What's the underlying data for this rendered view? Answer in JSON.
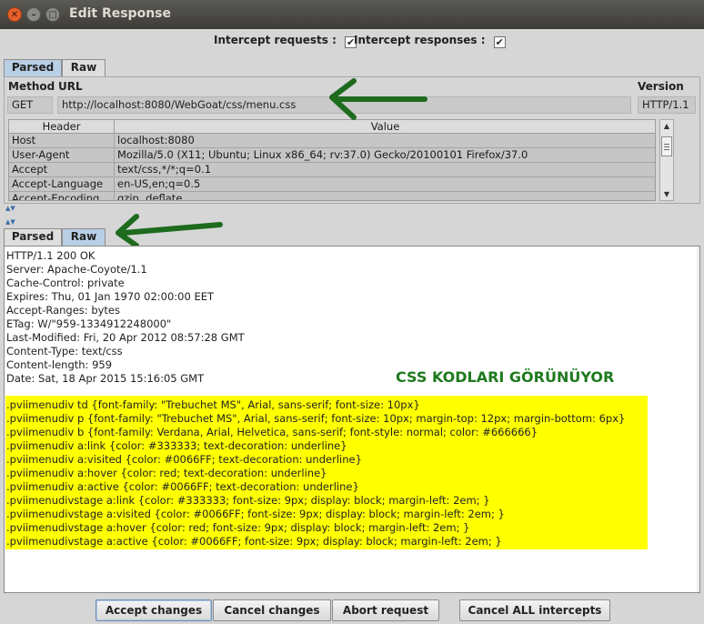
{
  "window": {
    "title": "Edit Response"
  },
  "intercept": {
    "requests_label": "Intercept requests :",
    "requests_checked": "✔",
    "responses_label": "Intercept responses :",
    "responses_checked": "✔"
  },
  "request_tabs": [
    {
      "label": "Parsed"
    },
    {
      "label": "Raw"
    }
  ],
  "request": {
    "method_label": "Method",
    "url_label": "URL",
    "version_label": "Version",
    "method": "GET",
    "url": "http://localhost:8080/WebGoat/css/menu.css",
    "version": "HTTP/1.1",
    "header_col": "Header",
    "value_col": "Value",
    "headers": [
      {
        "name": "Host",
        "value": "localhost:8080"
      },
      {
        "name": "User-Agent",
        "value": "Mozilla/5.0 (X11; Ubuntu; Linux x86_64; rv:37.0) Gecko/20100101 Firefox/37.0"
      },
      {
        "name": "Accept",
        "value": "text/css,*/*;q=0.1"
      },
      {
        "name": "Accept-Language",
        "value": "en-US,en;q=0.5"
      },
      {
        "name": "Accept-Encoding",
        "value": "gzip, deflate"
      }
    ]
  },
  "response_tabs": [
    {
      "label": "Parsed"
    },
    {
      "label": "Raw"
    }
  ],
  "response": {
    "headers_raw": [
      "HTTP/1.1 200 OK",
      "Server: Apache-Coyote/1.1",
      "Cache-Control: private",
      "Expires: Thu, 01 Jan 1970 02:00:00 EET",
      "Accept-Ranges: bytes",
      "ETag: W/\"959-1334912248000\"",
      "Last-Modified: Fri, 20 Apr 2012 08:57:28 GMT",
      "Content-Type: text/css",
      "Content-length: 959",
      "Date: Sat, 18 Apr 2015 15:16:05 GMT"
    ],
    "annotation": "CSS KODLARI GÖRÜNÜYOR",
    "css_lines": [
      ".pviimenudiv td {font-family: \"Trebuchet MS\", Arial, sans-serif; font-size: 10px}",
      ".pviimenudiv p {font-family: \"Trebuchet MS\", Arial, sans-serif; font-size: 10px; margin-top: 12px; margin-bottom: 6px}",
      ".pviimenudiv b {font-family: Verdana, Arial, Helvetica, sans-serif; font-style: normal; color: #666666}",
      ".pviimenudiv a:link {color: #333333; text-decoration: underline}",
      ".pviimenudiv a:visited {color: #0066FF; text-decoration: underline}",
      ".pviimenudiv a:hover {color: red; text-decoration: underline}",
      ".pviimenudiv a:active {color: #0066FF; text-decoration: underline}",
      ".pviimenudivstage a:link {color: #333333; font-size: 9px; display: block; margin-left: 2em; }",
      ".pviimenudivstage a:visited {color: #0066FF; font-size: 9px;  display: block; margin-left: 2em; }",
      ".pviimenudivstage a:hover {color: red; font-size: 9px;  display: block; margin-left: 2em; }",
      ".pviimenudivstage a:active {color: #0066FF; font-size: 9px;  display: block; margin-left: 2em; }"
    ]
  },
  "buttons": {
    "accept": "Accept changes",
    "cancel": "Cancel changes",
    "abort": "Abort request",
    "cancel_all": "Cancel ALL intercepts"
  },
  "colors": {
    "active_tab": "#b8cfe5",
    "highlight": "#ffff00",
    "annotation": "#1e7a1e",
    "arrow": "#1e6b1e"
  },
  "icons": [
    "close-icon",
    "minimize-icon",
    "maximize-icon",
    "checkmark-icon",
    "green-arrow-icon",
    "splitter-arrow-icon"
  ]
}
